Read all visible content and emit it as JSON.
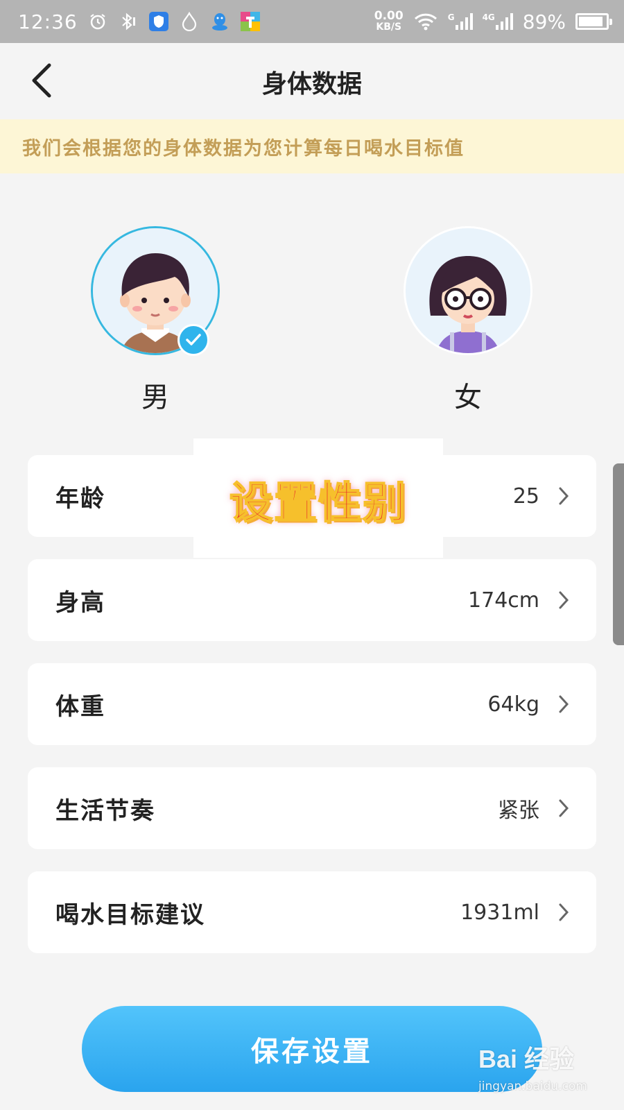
{
  "status_bar": {
    "time": "12:36",
    "net_speed_value": "0.00",
    "net_speed_unit": "KB/S",
    "signal1_label": "G",
    "signal2_label": "4G",
    "battery_text": "89%",
    "battery_level": 0.89,
    "icons": [
      "alarm-icon",
      "bluetooth-icon",
      "shield-app-icon",
      "water-drop-icon",
      "qq-icon",
      "colorful-app-icon",
      "wifi-icon",
      "signal-icon",
      "battery-icon"
    ]
  },
  "header": {
    "title": "身体数据"
  },
  "banner": {
    "text": "我们会根据您的身体数据为您计算每日喝水目标值"
  },
  "gender": {
    "male_label": "男",
    "female_label": "女",
    "selected": "male"
  },
  "overlay": {
    "text": "设置性别"
  },
  "rows": [
    {
      "label": "年龄",
      "value": "25"
    },
    {
      "label": "身高",
      "value": "174cm"
    },
    {
      "label": "体重",
      "value": "64kg"
    },
    {
      "label": "生活节奏",
      "value": "紧张"
    },
    {
      "label": "喝水目标建议",
      "value": "1931ml"
    }
  ],
  "save_button": {
    "label": "保存设置"
  },
  "watermark": {
    "logo": "Bai 经验",
    "url": "jingyan.baidu.com"
  },
  "colors": {
    "accent": "#2fb4ec",
    "banner_bg": "#fdf6d6",
    "banner_text": "#c39e57",
    "overlay_text": "#e8222a"
  }
}
